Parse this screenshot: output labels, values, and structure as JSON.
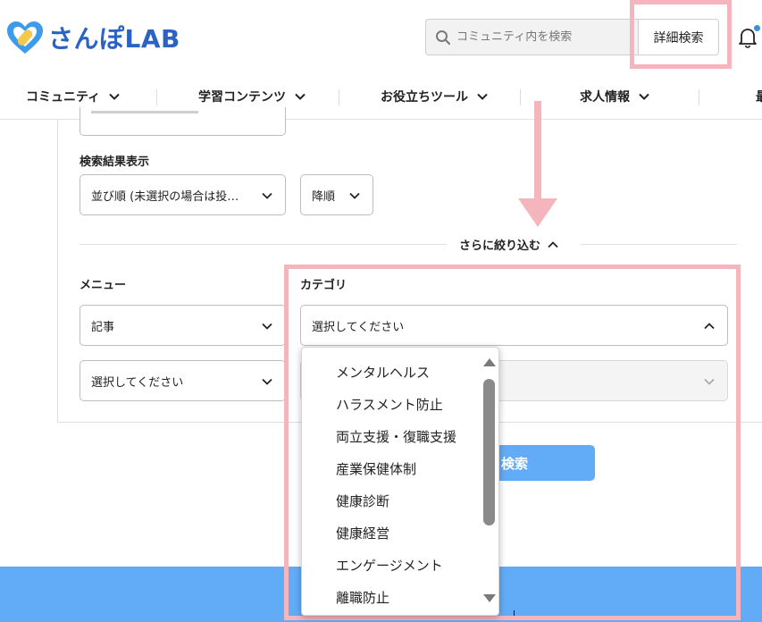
{
  "header": {
    "logo_text": "さんぽLAB",
    "search_placeholder": "コミュニティ内を検索",
    "advanced_search_label": "詳細検索"
  },
  "nav": {
    "items": [
      {
        "label": "コミュニティ"
      },
      {
        "label": "学習コンテンツ"
      },
      {
        "label": "お役立ちツール"
      },
      {
        "label": "求人情報"
      },
      {
        "label": "最"
      }
    ]
  },
  "form": {
    "sort_section_label": "検索結果表示",
    "sort_by_value": "並び順 (未選択の場合は投…",
    "sort_order_value": "降順",
    "refine_label": "さらに絞り込む",
    "menu_label": "メニュー",
    "menu_value": "記事",
    "category_label": "カテゴリ",
    "category_value": "選択してください",
    "sub_select_value": "選択してください",
    "search_button_label": "検索"
  },
  "category_options": [
    "メンタルヘルス",
    "ハラスメント防止",
    "両立支援・復職支援",
    "産業保健体制",
    "健康診断",
    "健康経営",
    "エンゲージメント",
    "離職防止"
  ],
  "colors": {
    "brand_blue": "#2a63c4",
    "button_blue": "#62acf7",
    "highlight_pink": "#f4b6bc"
  }
}
